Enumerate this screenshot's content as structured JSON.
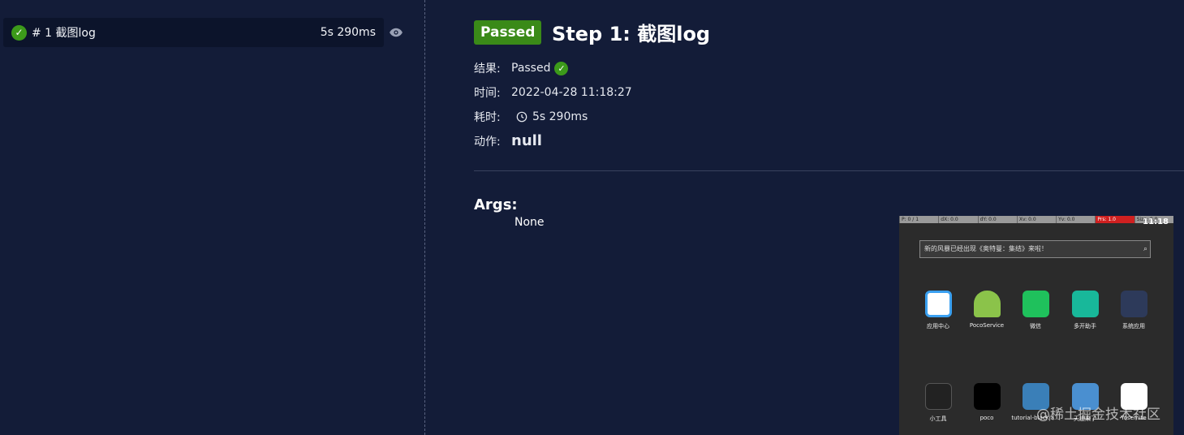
{
  "sidebar": {
    "step_label": "# 1 截图log",
    "step_duration": "5s 290ms"
  },
  "detail": {
    "badge": "Passed",
    "title": "Step 1: 截图log",
    "result_key": "结果:",
    "result_val": "Passed",
    "time_key": "时间:",
    "time_val": "2022-04-28 11:18:27",
    "duration_key": "耗时:",
    "duration_val": "5s 290ms",
    "action_key": "动作:",
    "action_val": "null",
    "args_title": "Args:",
    "args_val": "None"
  },
  "screenshot": {
    "status": [
      "P: 0 / 1",
      "dX: 0.0",
      "dY: 0.0",
      "Xv: 0.0",
      "Yv: 0.0",
      "Prs: 1.0",
      "Size: 0.0"
    ],
    "clock": "11:18",
    "search_text": "新的风暴已经出现《奥特曼：集结》来啦！",
    "apps_row1": [
      "应用中心",
      "PocoService",
      "微信",
      "多开助手",
      "系统应用"
    ],
    "apps_row2": [
      "小工具",
      "poco",
      "tutorial-blackja...",
      "天道来了",
      "Yosemite"
    ]
  },
  "watermark": "@稀土掘金技术社区",
  "colors": {
    "background": "#131c38",
    "passed_green": "#3a8a18",
    "passed_text": "#8bd06b"
  }
}
